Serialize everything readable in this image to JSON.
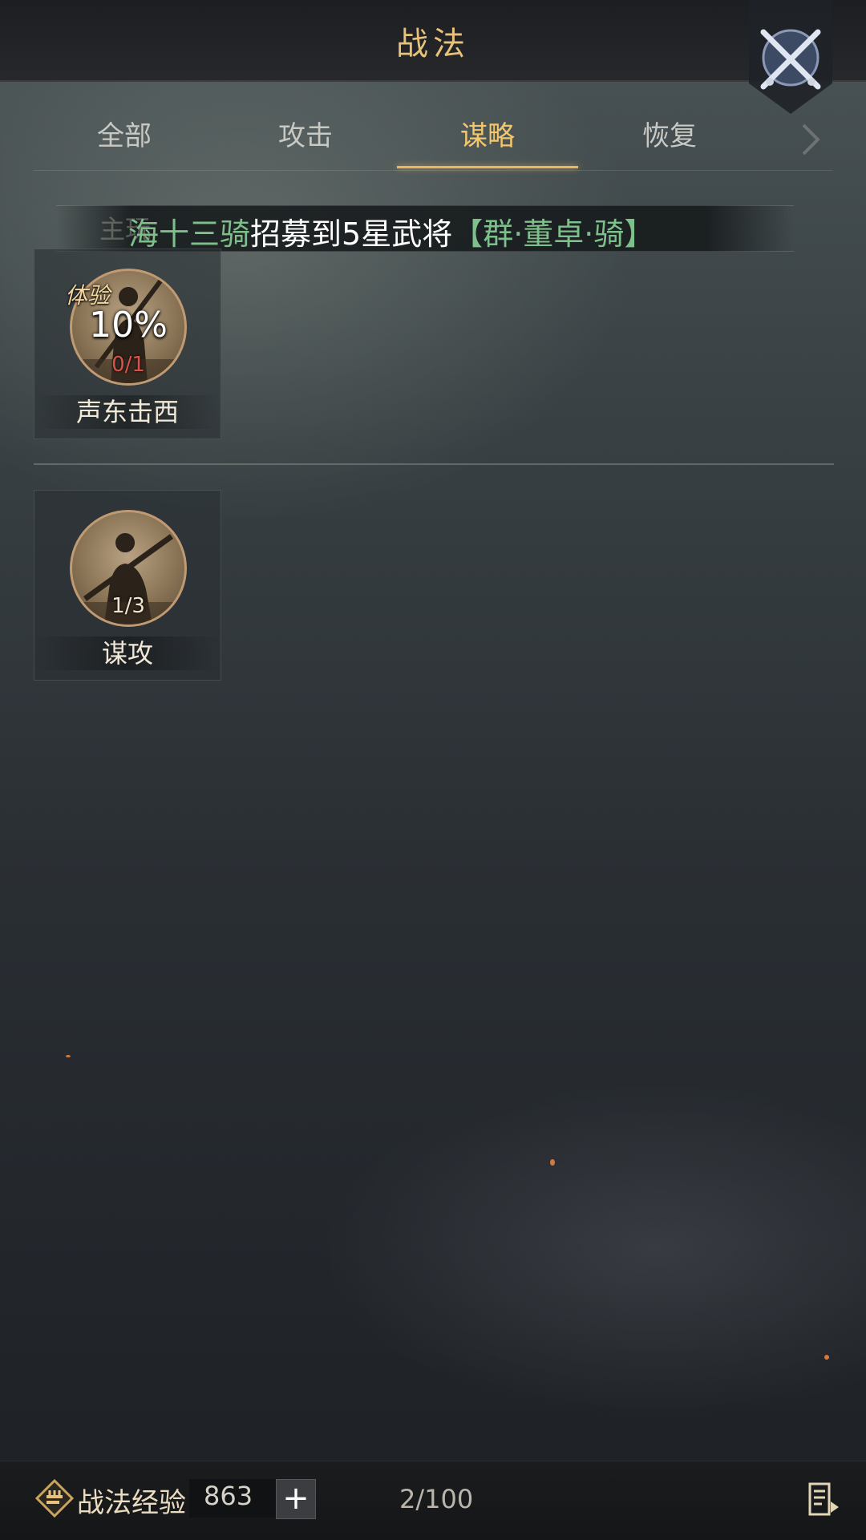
{
  "header": {
    "title": "战法"
  },
  "tabs": [
    {
      "label": "全部",
      "active": false
    },
    {
      "label": "攻击",
      "active": false
    },
    {
      "label": "谋略",
      "active": true
    },
    {
      "label": "恢复",
      "active": false
    }
  ],
  "banner": {
    "ghost_text": "主玩",
    "player_name": "海十三骑",
    "middle_text": "招募到5星武将",
    "general": "【群·董卓·骑】"
  },
  "skills": [
    {
      "name": "声东击西",
      "tag": "体验",
      "percent": "10%",
      "count": "0/1"
    },
    {
      "name": "谋攻",
      "count": "1/3"
    }
  ],
  "footer": {
    "exp_label": "战法经验",
    "exp_value": "863",
    "plus_label": "+",
    "capacity": "2/100"
  },
  "colors": {
    "accent": "#f3c76c",
    "highlight_green": "#7ec08a",
    "count_red": "#d9524a"
  },
  "icons": [
    "crossed-swords-icon",
    "chevron-right-icon",
    "exp-scroll-icon",
    "list-icon"
  ]
}
